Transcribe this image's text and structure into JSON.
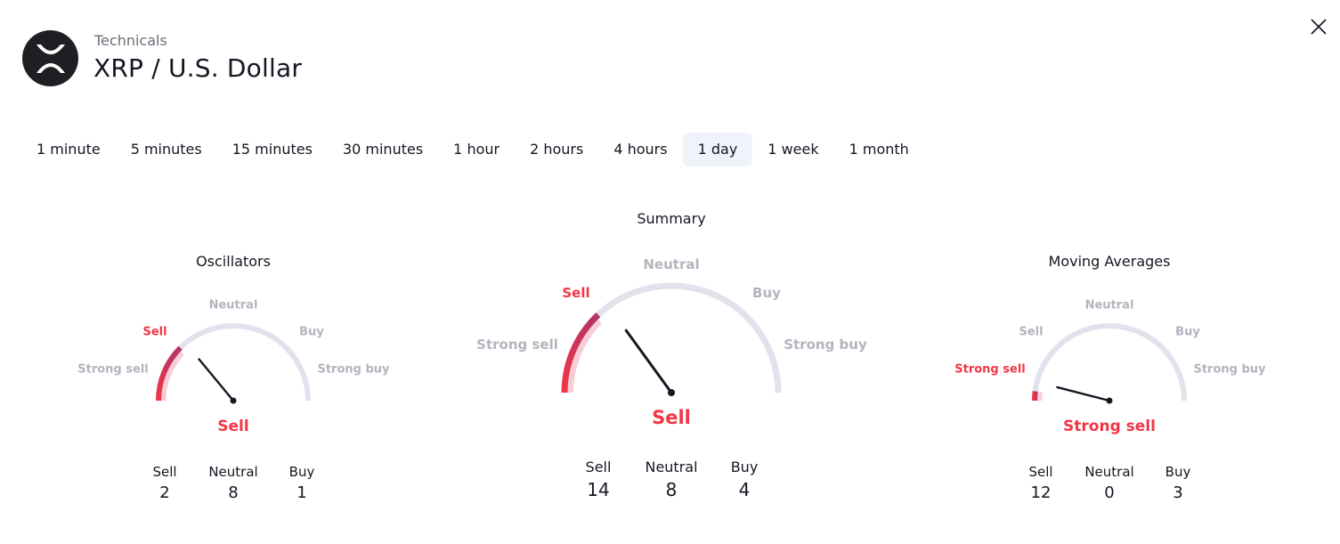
{
  "header": {
    "subtitle": "Technicals",
    "title": "XRP / U.S. Dollar",
    "logo_icon": "xrp-logo-icon",
    "close_icon": "close-icon"
  },
  "tabs": [
    {
      "label": "1 minute",
      "active": false
    },
    {
      "label": "5 minutes",
      "active": false
    },
    {
      "label": "15 minutes",
      "active": false
    },
    {
      "label": "30 minutes",
      "active": false
    },
    {
      "label": "1 hour",
      "active": false
    },
    {
      "label": "2 hours",
      "active": false
    },
    {
      "label": "4 hours",
      "active": false
    },
    {
      "label": "1 day",
      "active": true
    },
    {
      "label": "1 week",
      "active": false
    },
    {
      "label": "1 month",
      "active": false
    }
  ],
  "colors": {
    "sell": "#f23645",
    "sell_dark": "#b83468",
    "sell_light": "#f8cdd5",
    "track": "#e0e3eb",
    "needle": "#131722",
    "inactive_label": "#b2b5be"
  },
  "gauges": {
    "oscillators": {
      "title": "Oscillators",
      "scale_labels": {
        "strong_sell": "Strong sell",
        "sell": "Sell",
        "neutral": "Neutral",
        "buy": "Buy",
        "strong_buy": "Strong buy"
      },
      "active_label": "sell",
      "result": "Sell",
      "needle_fraction": 0.28,
      "fill_fraction": 0.25,
      "counts": {
        "sell_label": "Sell",
        "neutral_label": "Neutral",
        "buy_label": "Buy",
        "sell": "2",
        "neutral": "8",
        "buy": "1"
      }
    },
    "summary": {
      "title": "Summary",
      "scale_labels": {
        "strong_sell": "Strong sell",
        "sell": "Sell",
        "neutral": "Neutral",
        "buy": "Buy",
        "strong_buy": "Strong buy"
      },
      "active_label": "sell",
      "result": "Sell",
      "needle_fraction": 0.3,
      "fill_fraction": 0.26,
      "counts": {
        "sell_label": "Sell",
        "neutral_label": "Neutral",
        "buy_label": "Buy",
        "sell": "14",
        "neutral": "8",
        "buy": "4"
      }
    },
    "moving_averages": {
      "title": "Moving Averages",
      "scale_labels": {
        "strong_sell": "Strong sell",
        "sell": "Sell",
        "neutral": "Neutral",
        "buy": "Buy",
        "strong_buy": "Strong buy"
      },
      "active_label": "strong_sell",
      "result": "Strong sell",
      "needle_fraction": 0.08,
      "fill_fraction": 0.04,
      "counts": {
        "sell_label": "Sell",
        "neutral_label": "Neutral",
        "buy_label": "Buy",
        "sell": "12",
        "neutral": "0",
        "buy": "3"
      }
    }
  }
}
